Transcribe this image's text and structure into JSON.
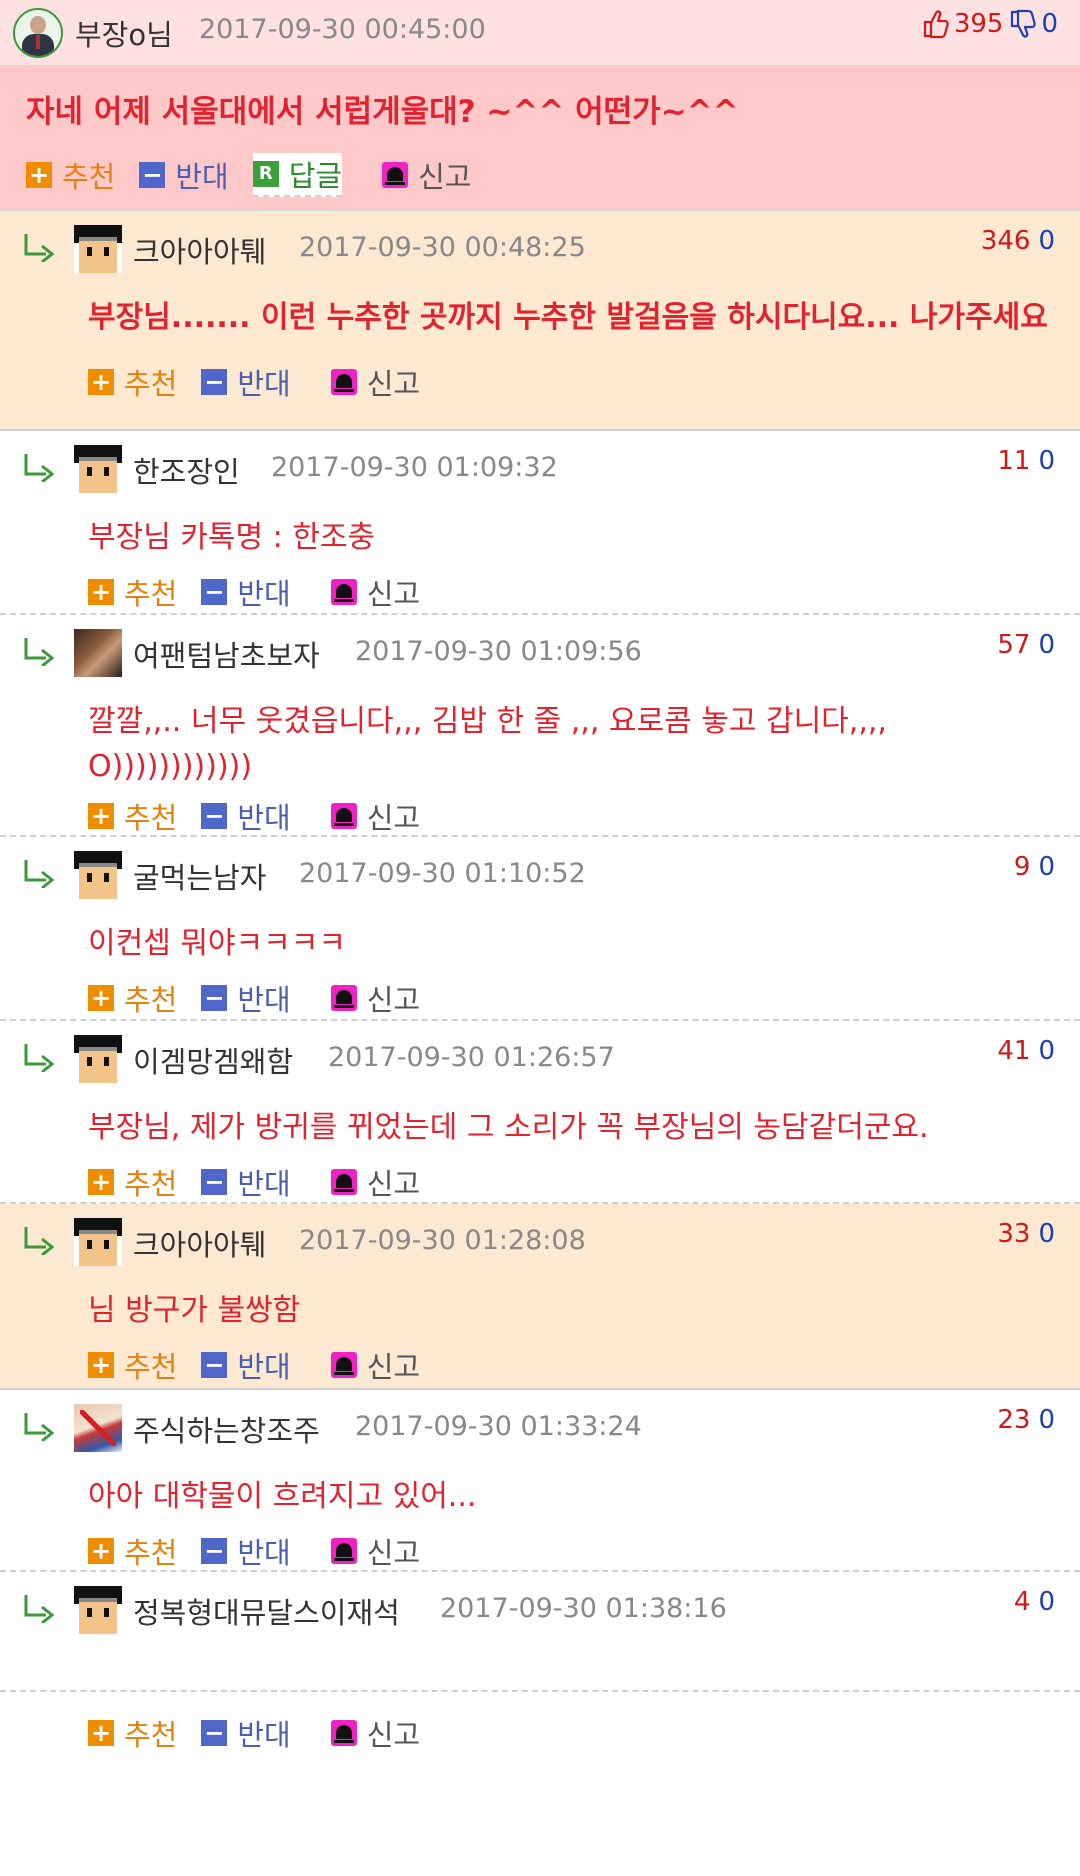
{
  "post": {
    "author": "부장o님",
    "date": "2017-09-30 00:45:00",
    "upvotes": "395",
    "downvotes": "0",
    "content": "자네 어제 서울대에서 서럽게울대? ~^^ 어떤가~^^",
    "actions": {
      "recommend": "추천",
      "oppose": "반대",
      "reply": "답글",
      "report": "신고",
      "recommend_icon": "+",
      "oppose_icon": "−",
      "reply_icon": "R"
    }
  },
  "reply_actions": {
    "recommend": "추천",
    "oppose": "반대",
    "report": "신고",
    "recommend_icon": "+",
    "oppose_icon": "−"
  },
  "replies": [
    {
      "author": "크아아아퉤",
      "date": "2017-09-30 00:48:25",
      "up": "346",
      "down": "0",
      "content": "부장님....... 이런 누추한 곳까지 누추한 발걸음을 하시다니요... 나가주세요"
    },
    {
      "author": "한조장인",
      "date": "2017-09-30 01:09:32",
      "up": "11",
      "down": "0",
      "content": "부장님 카톡명 : 한조충"
    },
    {
      "author": "여팬텀남초보자",
      "date": "2017-09-30 01:09:56",
      "up": "57",
      "down": "0",
      "content": "깔깔,,.. 너무 웃겼읍니다,,, 김밥 한 줄 ,,, 요로콤 놓고 갑니다,,,, O))))))))))))"
    },
    {
      "author": "굴먹는남자",
      "date": "2017-09-30 01:10:52",
      "up": "9",
      "down": "0",
      "content": "이컨셉 뭐야ㅋㅋㅋㅋ"
    },
    {
      "author": "이겜망겜왜함",
      "date": "2017-09-30 01:26:57",
      "up": "41",
      "down": "0",
      "content": "부장님, 제가 방귀를 뀌었는데 그 소리가 꼭 부장님의 농담같더군요."
    },
    {
      "author": "크아아아퉤",
      "date": "2017-09-30 01:28:08",
      "up": "33",
      "down": "0",
      "content": "님 방구가 불쌍함"
    },
    {
      "author": "주식하는창조주",
      "date": "2017-09-30 01:33:24",
      "up": "23",
      "down": "0",
      "content": "아아 대학물이 흐려지고 있어..."
    },
    {
      "author": "정복형대뮤달스이재석",
      "date": "2017-09-30 01:38:16",
      "up": "4",
      "down": "0",
      "content": ""
    }
  ]
}
